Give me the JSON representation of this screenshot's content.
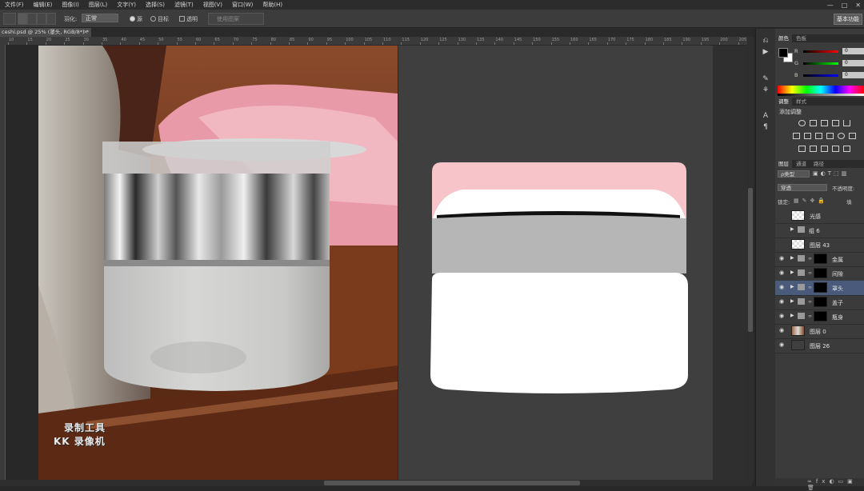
{
  "menu": [
    "文件(F)",
    "编辑(E)",
    "图像(I)",
    "图层(L)",
    "文字(Y)",
    "选择(S)",
    "滤镜(T)",
    "视图(V)",
    "窗口(W)",
    "帮助(H)"
  ],
  "options": {
    "feather_label": "羽化:",
    "mode_value": "正常",
    "source_label": "源",
    "target_label": "目标",
    "transparent_label": "透明",
    "use_pattern_label": "使用图案",
    "workspace_label": "基本功能"
  },
  "document": {
    "tab_title": "ceshi.psd @ 25% (罩头, RGB/8*) *",
    "close_glyph": "×"
  },
  "ruler": [
    "10",
    "15",
    "20",
    "25",
    "30",
    "35",
    "40",
    "45",
    "50",
    "55",
    "60",
    "65",
    "70",
    "75",
    "80",
    "85",
    "90",
    "95",
    "100",
    "105",
    "110",
    "115",
    "120",
    "125",
    "130",
    "135",
    "140",
    "145",
    "150",
    "155",
    "160",
    "165",
    "170",
    "175",
    "180",
    "185",
    "190",
    "195",
    "200",
    "205"
  ],
  "color_panel": {
    "tabs": [
      "颜色",
      "色板"
    ],
    "channels": [
      {
        "label": "R",
        "value": "0"
      },
      {
        "label": "G",
        "value": "0"
      },
      {
        "label": "B",
        "value": "0"
      }
    ]
  },
  "adjust_panel": {
    "tabs": [
      "调整",
      "样式"
    ],
    "title": "添加调整"
  },
  "layers_panel": {
    "tabs": [
      "图层",
      "通道",
      "路径"
    ],
    "filter_label": "ρ类型",
    "blend_mode": "穿透",
    "opacity_label": "不透明度:",
    "lock_label": "锁定:",
    "fill_label": "填",
    "layers": [
      {
        "name": "光感",
        "type": "pixel",
        "visible": false,
        "selected": false
      },
      {
        "name": "组 6",
        "type": "group",
        "visible": false,
        "selected": false
      },
      {
        "name": "图层 43",
        "type": "pixel",
        "visible": false,
        "selected": false
      },
      {
        "name": "金属",
        "type": "group-mask",
        "visible": true,
        "selected": false
      },
      {
        "name": "间隙",
        "type": "group-mask",
        "visible": true,
        "selected": false
      },
      {
        "name": "罩头",
        "type": "group-mask",
        "visible": true,
        "selected": true
      },
      {
        "name": "盖子",
        "type": "group-mask",
        "visible": true,
        "selected": false
      },
      {
        "name": "瓶身",
        "type": "group-mask",
        "visible": true,
        "selected": false
      },
      {
        "name": "图层 0",
        "type": "photo",
        "visible": true,
        "selected": false
      },
      {
        "name": "图层 26",
        "type": "fill",
        "visible": true,
        "selected": false
      }
    ]
  },
  "watermark": {
    "line1": "录制工具",
    "line2": "KK 录像机"
  },
  "icons": {
    "eye": "eye-icon",
    "folder": "folder-icon",
    "link": "link-icon"
  },
  "colors": {
    "foreground": "#000000",
    "background": "#ffffff",
    "pink": "#f7c4c9",
    "gray_band": "#b6b6b6",
    "selected_layer": "#4a5a7a"
  }
}
